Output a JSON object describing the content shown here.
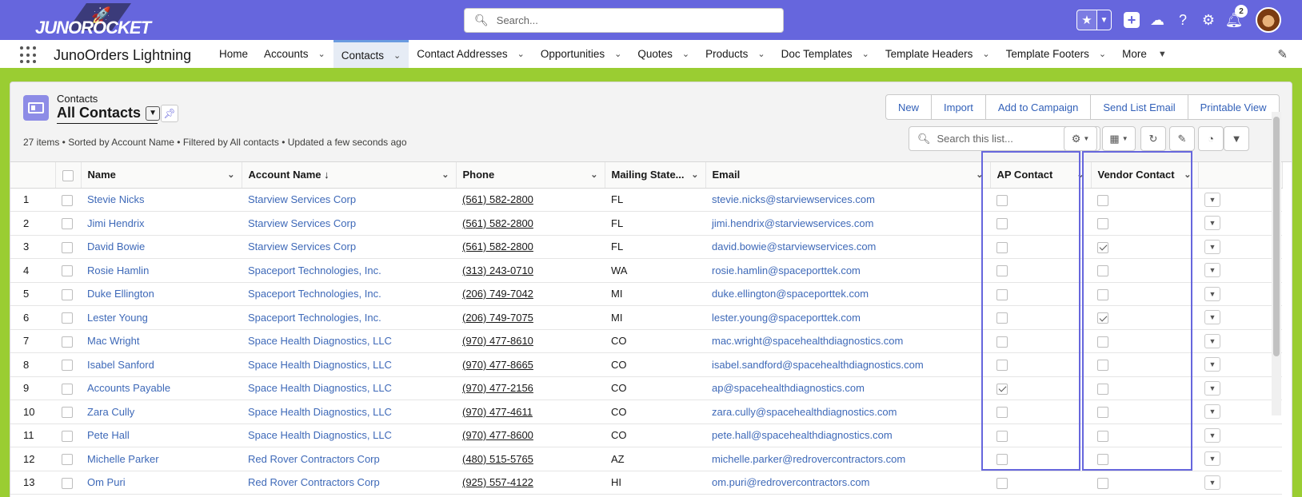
{
  "header": {
    "logo_text": "JUNOROCKET",
    "search_placeholder": "Search...",
    "notification_count": "2"
  },
  "nav": {
    "app_name": "JunoOrders Lightning",
    "items": [
      {
        "label": "Home",
        "chevron": false,
        "active": false
      },
      {
        "label": "Accounts",
        "chevron": true,
        "active": false
      },
      {
        "label": "Contacts",
        "chevron": true,
        "active": true
      },
      {
        "label": "Contact Addresses",
        "chevron": true,
        "active": false
      },
      {
        "label": "Opportunities",
        "chevron": true,
        "active": false
      },
      {
        "label": "Quotes",
        "chevron": true,
        "active": false
      },
      {
        "label": "Products",
        "chevron": true,
        "active": false
      },
      {
        "label": "Doc Templates",
        "chevron": true,
        "active": false
      },
      {
        "label": "Template Headers",
        "chevron": true,
        "active": false
      },
      {
        "label": "Template Footers",
        "chevron": true,
        "active": false
      },
      {
        "label": "More",
        "chevron": false,
        "active": false,
        "caret": true
      }
    ]
  },
  "list": {
    "object_label": "Contacts",
    "view_name": "All Contacts",
    "info": "27 items • Sorted by Account Name • Filtered by All contacts • Updated a few seconds ago",
    "buttons": [
      "New",
      "Import",
      "Add to Campaign",
      "Send List Email",
      "Printable View"
    ],
    "search_placeholder": "Search this list..."
  },
  "table": {
    "columns": [
      "",
      "",
      "Name",
      "Account Name ↓",
      "Phone",
      "Mailing State...",
      "Email",
      "AP Contact",
      "Vendor Contact",
      ""
    ],
    "rows": [
      {
        "n": "1",
        "name": "Stevie Nicks",
        "account": "Starview Services Corp",
        "phone": "(561) 582-2800",
        "state": "FL",
        "email": "stevie.nicks@starviewservices.com",
        "ap": false,
        "vendor": false
      },
      {
        "n": "2",
        "name": "Jimi Hendrix",
        "account": "Starview Services Corp",
        "phone": "(561) 582-2800",
        "state": "FL",
        "email": "jimi.hendrix@starviewservices.com",
        "ap": false,
        "vendor": false
      },
      {
        "n": "3",
        "name": "David Bowie",
        "account": "Starview Services Corp",
        "phone": "(561) 582-2800",
        "state": "FL",
        "email": "david.bowie@starviewservices.com",
        "ap": false,
        "vendor": true
      },
      {
        "n": "4",
        "name": "Rosie Hamlin",
        "account": "Spaceport Technologies, Inc.",
        "phone": "(313) 243-0710",
        "state": "WA",
        "email": "rosie.hamlin@spaceporttek.com",
        "ap": false,
        "vendor": false
      },
      {
        "n": "5",
        "name": "Duke Ellington",
        "account": "Spaceport Technologies, Inc.",
        "phone": "(206) 749-7042",
        "state": "MI",
        "email": "duke.ellington@spaceporttek.com",
        "ap": false,
        "vendor": false
      },
      {
        "n": "6",
        "name": "Lester Young",
        "account": "Spaceport Technologies, Inc.",
        "phone": "(206) 749-7075",
        "state": "MI",
        "email": "lester.young@spaceporttek.com",
        "ap": false,
        "vendor": true
      },
      {
        "n": "7",
        "name": "Mac Wright",
        "account": "Space Health Diagnostics, LLC",
        "phone": "(970) 477-8610",
        "state": "CO",
        "email": "mac.wright@spacehealthdiagnostics.com",
        "ap": false,
        "vendor": false
      },
      {
        "n": "8",
        "name": "Isabel Sanford",
        "account": "Space Health Diagnostics, LLC",
        "phone": "(970) 477-8665",
        "state": "CO",
        "email": "isabel.sandford@spacehealthdiagnostics.com",
        "ap": false,
        "vendor": false
      },
      {
        "n": "9",
        "name": "Accounts Payable",
        "account": "Space Health Diagnostics, LLC",
        "phone": "(970) 477-2156",
        "state": "CO",
        "email": "ap@spacehealthdiagnostics.com",
        "ap": true,
        "vendor": false
      },
      {
        "n": "10",
        "name": "Zara Cully",
        "account": "Space Health Diagnostics, LLC",
        "phone": "(970) 477-4611",
        "state": "CO",
        "email": "zara.cully@spacehealthdiagnostics.com",
        "ap": false,
        "vendor": false
      },
      {
        "n": "11",
        "name": "Pete Hall",
        "account": "Space Health Diagnostics, LLC",
        "phone": "(970) 477-8600",
        "state": "CO",
        "email": "pete.hall@spacehealthdiagnostics.com",
        "ap": false,
        "vendor": false
      },
      {
        "n": "12",
        "name": "Michelle Parker",
        "account": "Red Rover Contractors Corp",
        "phone": "(480) 515-5765",
        "state": "AZ",
        "email": "michelle.parker@redrovercontractors.com",
        "ap": false,
        "vendor": false
      },
      {
        "n": "13",
        "name": "Om Puri",
        "account": "Red Rover Contractors Corp",
        "phone": "(925) 557-4122",
        "state": "HI",
        "email": "om.puri@redrovercontractors.com",
        "ap": false,
        "vendor": false
      }
    ]
  },
  "colors": {
    "header_bg": "#6666dd",
    "page_bg": "#9acd32",
    "link": "#3e69b8",
    "highlight": "#6666dd"
  }
}
